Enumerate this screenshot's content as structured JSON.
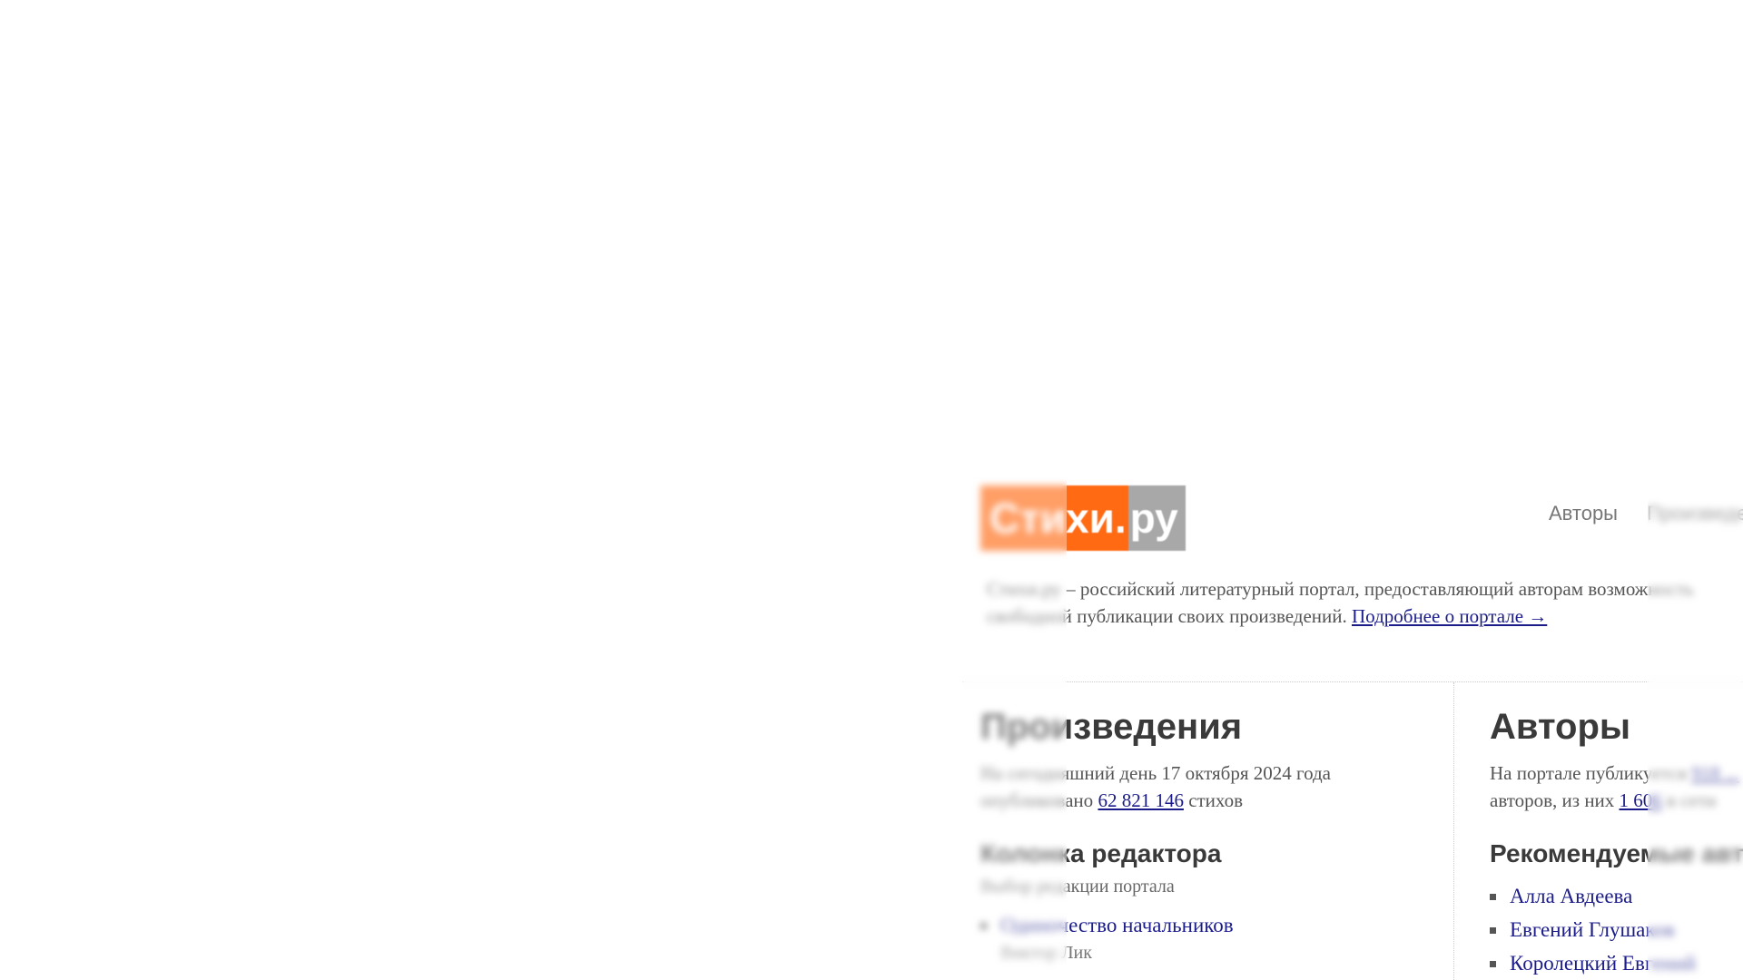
{
  "logo": {
    "part1": "Стихи.",
    "part2": "ру"
  },
  "topnav": {
    "items": [
      "Авторы",
      "Произведения"
    ]
  },
  "intro": {
    "text_start": "Стихи.ру",
    "text_main": " – российский литературный портал, предоставляющий авторам возможность свободной публикации своих произведений. ",
    "more_link": "Подробнее о портале →"
  },
  "works": {
    "title": "Произведения",
    "stat_prefix": "На сегодняшний день 17 октября 2024 года опубликовано ",
    "stat_count": "62 821 146",
    "stat_suffix": " стихов",
    "editor_title": "Колонка редактора",
    "editor_sub": "Выбор редакции портала",
    "items": [
      {
        "title": "Одиночество начальников",
        "author": "Виктор Лик"
      }
    ]
  },
  "authors": {
    "title": "Авторы",
    "stat_prefix": "На портале публикуется ",
    "stat_count": "918 ...",
    "stat_middle": " авторов, из них ",
    "stat_online": "1 606",
    "stat_suffix": " в сети",
    "recommended_title": "Рекомендуемые авторы",
    "items": [
      "Алла Авдеева",
      "Евгений Глушаков",
      "Королецкий Евгений"
    ]
  },
  "colors": {
    "logo_orange": "#ff6a13",
    "logo_gray": "#a8a8a8",
    "link": "#1b1c8a"
  }
}
